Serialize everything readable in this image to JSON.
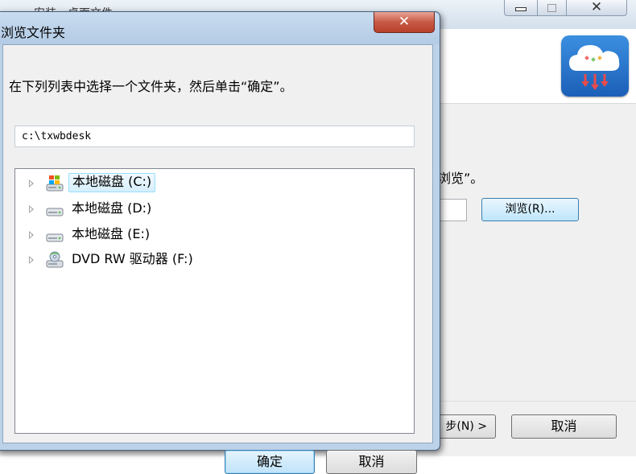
{
  "background_window": {
    "title": "安装 - 桌面文件",
    "instruction_suffix": "浏览”。",
    "browse_button_label": "浏览(R)...",
    "next_button_label": "步(N) >",
    "cancel_button_label": "取消",
    "logo_icon": "cloud-download-icon",
    "controls": {
      "minimize_icon": "minimize-icon",
      "maximize_icon": "maximize-icon",
      "close_glyph": "✕"
    }
  },
  "dialog": {
    "title": "浏览文件夹",
    "close_glyph": "✕",
    "prompt": "在下列列表中选择一个文件夹，然后单击“确定”。",
    "path_value": "c:\\txwbdesk",
    "tree": [
      {
        "label": "本地磁盘 (C:)",
        "icon": "system-drive-icon",
        "selected": true
      },
      {
        "label": "本地磁盘 (D:)",
        "icon": "hard-drive-icon",
        "selected": false
      },
      {
        "label": "本地磁盘 (E:)",
        "icon": "hard-drive-icon",
        "selected": false
      },
      {
        "label": "DVD RW 驱动器 (F:)",
        "icon": "dvd-drive-icon",
        "selected": false
      }
    ],
    "ok_label": "确定",
    "cancel_label": "取消"
  },
  "colors": {
    "selection_fill": "#d5effc",
    "selection_border": "#99defd",
    "close_button": "#c75a45",
    "default_button_border": "#3c7fb1"
  }
}
